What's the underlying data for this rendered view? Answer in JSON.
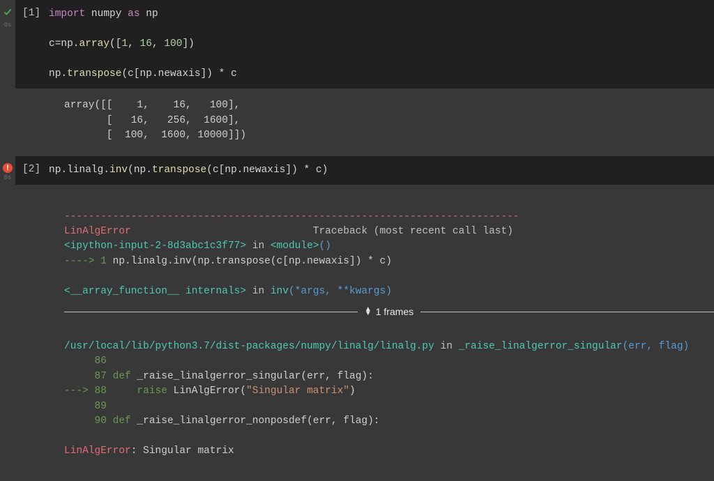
{
  "cell1": {
    "status_time": "0s",
    "prompt": "[1]",
    "code": {
      "kw_import": "import",
      "pkg_numpy": "numpy",
      "kw_as": "as",
      "alias_np": "np",
      "line2_a": "c=np.",
      "line2_func": "array",
      "line2_b": "([",
      "n1": "1",
      "c1": ", ",
      "n2": "16",
      "c2": ", ",
      "n3": "100",
      "line2_end": "])",
      "line3_a": "np.",
      "line3_func": "transpose",
      "line3_b": "(c[np.newaxis]) * c"
    },
    "output": "array([[    1,    16,   100],\n       [   16,   256,  1600],\n       [  100,  1600, 10000]])"
  },
  "cell2": {
    "status_time": "0s",
    "prompt": "[2]",
    "code": {
      "pre": "np.linalg.",
      "func": "inv",
      "mid_a": "(np.",
      "func2": "transpose",
      "mid_b": "(c[np.newaxis]) * c)"
    },
    "traceback": {
      "dashes": "---------------------------------------------------------------------------",
      "err": "LinAlgError",
      "tb_label": "                              Traceback (most recent call last)",
      "l1_a": "<ipython-input-2-8d3abc1c3f77>",
      "l1_in": " in ",
      "l1_b": "<module>",
      "l1_c": "()",
      "l2_arrow": "----> 1",
      "l2_code_a": " np",
      "l2_code_b": ".linalg.inv",
      "l2_code_c": "(np",
      "l2_code_d": ".transpose",
      "l2_code_e": "(c",
      "l2_code_f": "[np",
      "l2_code_g": ".newaxis",
      "l2_code_h": "]) * c)",
      "l3_a": "<__array_function__ internals>",
      "l3_in": " in ",
      "l3_b": "inv",
      "l3_c": "(*args, **kwargs)",
      "frames_label": "1 frames",
      "file": "/usr/local/lib/python3.7/dist-packages/numpy/linalg/linalg.py",
      "file_in": " in ",
      "file_func": "_raise_linalgerror_singular",
      "file_args": "(err, flag)",
      "s86": "     86",
      "s87": "     87 ",
      "s87_def": "def",
      "s87_name": " _raise_linalgerror_singular",
      "s87_args": "(err, flag):",
      "s88_arrow": "---> 88     ",
      "s88_raise": "raise",
      "s88_err": " LinAlgError",
      "s88_paren_o": "(",
      "s88_str": "\"Singular matrix\"",
      "s88_paren_c": ")",
      "s89": "     89",
      "s90": "     90 ",
      "s90_def": "def",
      "s90_name": " _raise_linalgerror_nonposdef",
      "s90_args": "(err, flag):",
      "final_err": "LinAlgError",
      "final_colon": ": ",
      "final_msg": "Singular matrix"
    }
  }
}
